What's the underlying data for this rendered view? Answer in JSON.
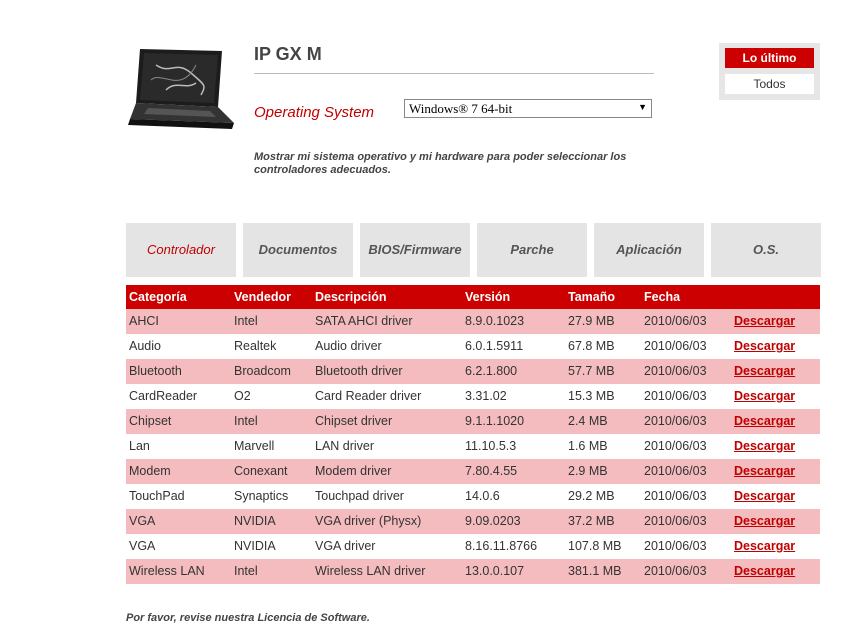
{
  "product": {
    "title": "IP GX M",
    "image": "laptop-image"
  },
  "os": {
    "label": "Operating System",
    "selected": "Windows® 7 64-bit"
  },
  "note": "Mostrar mi sistema operativo y mi hardware para poder seleccionar los controladores adecuados.",
  "filters": {
    "latest": "Lo último",
    "all": "Todos"
  },
  "tabs": [
    "Controlador",
    "Documentos",
    "BIOS/Firmware",
    "Parche",
    "Aplicación",
    "O.S."
  ],
  "table": {
    "headers": [
      "Categoría",
      "Vendedor",
      "Descripción",
      "Versión",
      "Tamaño",
      "Fecha"
    ],
    "download_label": "Descargar",
    "rows": [
      [
        "AHCI",
        "Intel",
        "SATA AHCI driver",
        "8.9.0.1023",
        "27.9 MB",
        "2010/06/03"
      ],
      [
        "Audio",
        "Realtek",
        "Audio driver",
        "6.0.1.5911",
        "67.8 MB",
        "2010/06/03"
      ],
      [
        "Bluetooth",
        "Broadcom",
        "Bluetooth driver",
        "6.2.1.800",
        "57.7 MB",
        "2010/06/03"
      ],
      [
        "CardReader",
        "O2",
        "Card Reader driver",
        "3.31.02",
        "15.3 MB",
        "2010/06/03"
      ],
      [
        "Chipset",
        "Intel",
        "Chipset driver",
        "9.1.1.1020",
        "2.4 MB",
        "2010/06/03"
      ],
      [
        "Lan",
        "Marvell",
        "LAN driver",
        "11.10.5.3",
        "1.6 MB",
        "2010/06/03"
      ],
      [
        "Modem",
        "Conexant",
        "Modem driver",
        "7.80.4.55",
        "2.9 MB",
        "2010/06/03"
      ],
      [
        "TouchPad",
        "Synaptics",
        "Touchpad driver",
        "14.0.6",
        "29.2 MB",
        "2010/06/03"
      ],
      [
        "VGA",
        "NVIDIA",
        "VGA driver (Physx)",
        "9.09.0203",
        "37.2 MB",
        "2010/06/03"
      ],
      [
        "VGA",
        "NVIDIA",
        "VGA driver",
        "8.16.11.8766",
        "107.8 MB",
        "2010/06/03"
      ],
      [
        "Wireless LAN",
        "Intel",
        "Wireless LAN driver",
        "13.0.0.107",
        "381.1 MB",
        "2010/06/03"
      ]
    ]
  },
  "license": "Por favor, revise nuestra Licencia de Software.",
  "colors": {
    "accent": "#cc0000",
    "row_alt": "#f5bcbf",
    "tab_bg": "#e4e4e4"
  }
}
